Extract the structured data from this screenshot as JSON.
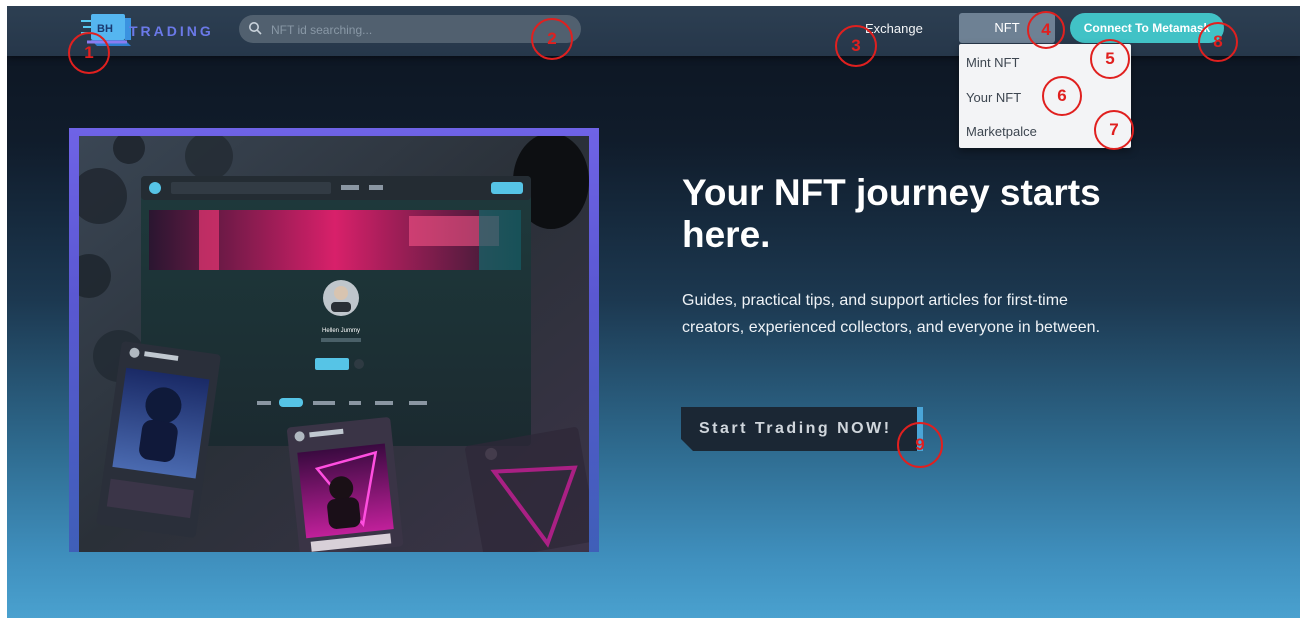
{
  "navbar": {
    "logo_text": "TRADING",
    "logo_badge": "BH",
    "search_placeholder": "NFT id searching...",
    "exchange_label": "Exchange",
    "nft_label": "NFT",
    "connect_label": "Connect To Metamask"
  },
  "dropdown": {
    "items": [
      {
        "label": "Mint NFT"
      },
      {
        "label": "Your NFT"
      },
      {
        "label": "Marketpalce"
      }
    ]
  },
  "hero": {
    "title": "Your NFT journey starts here.",
    "description": "Guides, practical tips, and support articles for first-time creators, experienced collectors, and everyone in between.",
    "cta_label": "Start Trading NOW!",
    "mock_profile_name": "Hellen Jummy"
  },
  "callouts": [
    "1",
    "2",
    "3",
    "4",
    "5",
    "6",
    "7",
    "8",
    "9"
  ],
  "colors": {
    "accent": "#41c2c6",
    "callout": "#e0201f",
    "logo": "#6b79e8",
    "navbar": "#2a3b4e"
  }
}
